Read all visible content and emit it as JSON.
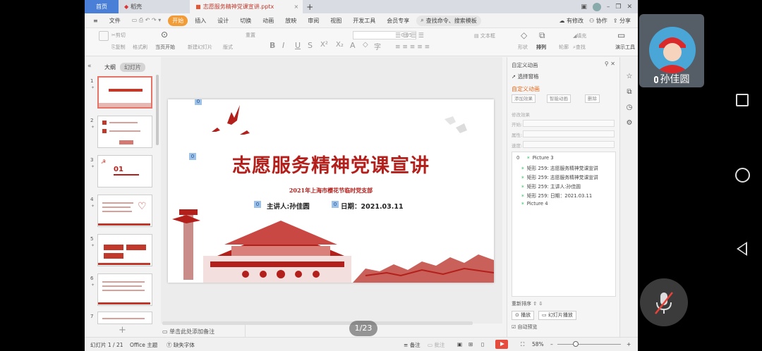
{
  "tabstrip": {
    "home": "首页",
    "shell": "稻壳",
    "doc_title": "志愿服务精神党课宣讲.pptx"
  },
  "menu": {
    "file": "文件",
    "items": [
      "开始",
      "插入",
      "设计",
      "切换",
      "动画",
      "放映",
      "审阅",
      "视图",
      "开发工具",
      "会员专享"
    ],
    "search": "查找命令、搜索模板",
    "right": [
      "有修改",
      "协作",
      "分享"
    ]
  },
  "ribbon": {
    "cut": "剪切",
    "copy": "复制",
    "format_painter": "格式刷",
    "start_from_current": "当页开始",
    "new_slide": "新建幻灯片",
    "layout": "版式",
    "reset": "重置",
    "font_size": "-0.05",
    "text_box": "文本框",
    "shapes": "形状",
    "arrange": "排列",
    "outline": "轮廓",
    "fill": "填充",
    "find": "查找",
    "presentation_tool": "演示工具"
  },
  "left_panel": {
    "tab_outline": "大纲",
    "tab_slides": "幻灯片",
    "thumb_numbers": [
      "1",
      "2",
      "3",
      "4",
      "5",
      "6",
      "7"
    ],
    "thumb3_text": "01"
  },
  "slide": {
    "title": "志愿服务精神党课宣讲",
    "subtitle": "2021年上海市樱花节临时党支部",
    "speaker": "主讲人:孙佳圆",
    "date": "日期：2021.03.11",
    "anim_tags": [
      "0",
      "0",
      "0",
      "0"
    ]
  },
  "canvas": {
    "add_note": "单击此处添加备注",
    "page_indicator": "1/23"
  },
  "anim_panel": {
    "title": "自定义动画",
    "select_pane": "选择窗格",
    "custom_anim": "自定义动画",
    "add_effect": "添加效果",
    "smart_anim": "智能动画",
    "delete": "删除",
    "modify_effect": "修改效果",
    "label_start": "开始:",
    "label_property": "属性:",
    "label_speed": "速度:",
    "list": [
      {
        "n": "0",
        "name": "Picture 3"
      },
      {
        "n": "",
        "name": "矩形 259: 志愿服务精神党课宣讲"
      },
      {
        "n": "",
        "name": "矩形 259: 志愿服务精神党课宣讲"
      },
      {
        "n": "",
        "name": "矩形 259: 主讲人:孙佳圆"
      },
      {
        "n": "",
        "name": "矩形 259: 日期：2021.03.11"
      },
      {
        "n": "",
        "name": "Picture 4"
      }
    ],
    "reorder": "重新排序",
    "play": "播放",
    "slideshow": "幻灯片播放",
    "auto_preview": "自动预览"
  },
  "status": {
    "slide_count": "幻灯片 1 / 21",
    "theme": "Office 主题",
    "missing_font": "缺失字体",
    "notes": "备注",
    "comments": "批注",
    "zoom": "58%"
  },
  "call": {
    "name": "孙佳圆"
  },
  "colors": {
    "accent_orange": "#f29c38",
    "slide_red": "#b3201c",
    "home_tab_blue": "#4a7fd8"
  }
}
